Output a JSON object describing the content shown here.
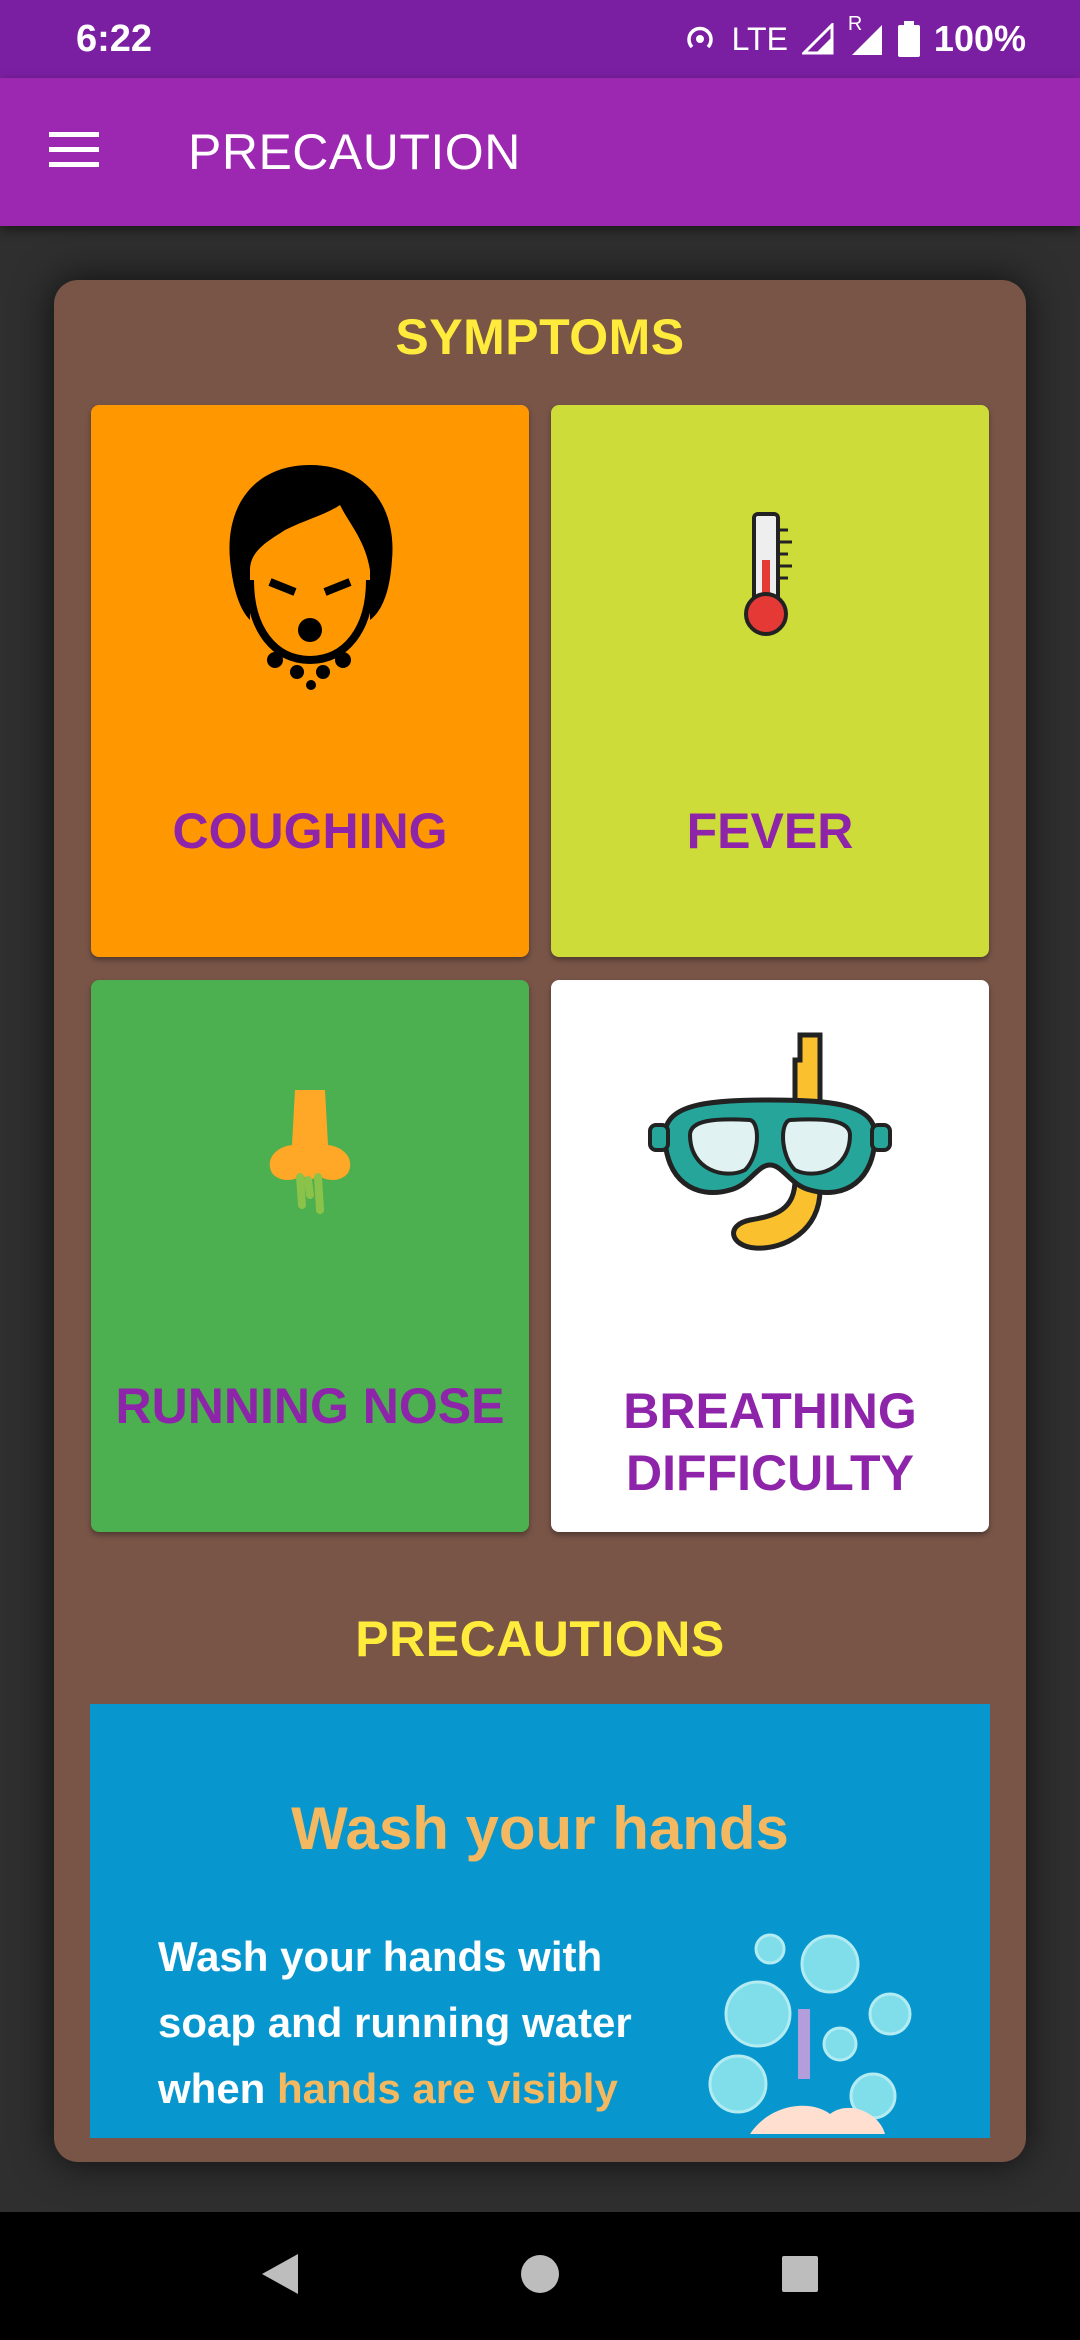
{
  "status_bar": {
    "time": "6:22",
    "network": "LTE",
    "roaming": "R",
    "battery": "100%"
  },
  "app_bar": {
    "title": "PRECAUTION",
    "menu_icon": "hamburger-menu-icon"
  },
  "symptoms": {
    "title": "SYMPTOMS",
    "items": [
      {
        "label": "COUGHING",
        "icon": "coughing-face-icon",
        "color": "#ff9800"
      },
      {
        "label": "FEVER",
        "icon": "thermometer-icon",
        "color": "#cddc39"
      },
      {
        "label": "RUNNING NOSE",
        "icon": "running-nose-icon",
        "color": "#4caf50"
      },
      {
        "label_line1": "BREATHING",
        "label_line2": "DIFFICULTY",
        "icon": "diving-mask-icon",
        "color": "#ffffff"
      }
    ]
  },
  "precautions": {
    "title": "PRECAUTIONS",
    "banner": {
      "title": "Wash your hands",
      "line1": "Wash your hands with",
      "line2": "soap and running water",
      "line3_a": "when ",
      "line3_b": "hands are visibly",
      "art_icon": "soap-bubbles-hands-icon"
    }
  },
  "nav_bar": {
    "back_icon": "back-triangle-icon",
    "home_icon": "home-circle-icon",
    "recents_icon": "recents-square-icon"
  },
  "colors": {
    "status_bar": "#7b1fa2",
    "app_bar": "#9c27b0",
    "panel": "#795548",
    "section_title": "#ffeb3b",
    "tile_label": "#8e24aa"
  }
}
